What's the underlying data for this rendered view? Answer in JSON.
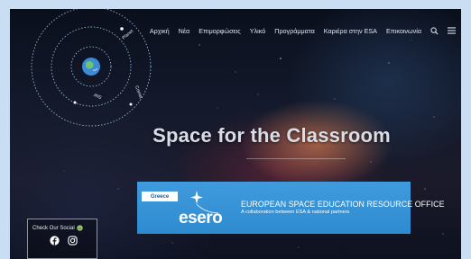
{
  "nav": {
    "items": [
      {
        "label": "Αρχική"
      },
      {
        "label": "Νέα"
      },
      {
        "label": "Επιμορφώσεις"
      },
      {
        "label": "Υλικό"
      },
      {
        "label": "Προγράμματα"
      },
      {
        "label": "Καριέρα στην ESA"
      },
      {
        "label": "Επικοινωνία"
      }
    ],
    "search_icon": "search-icon",
    "menu_icon": "hamburger-menu-icon"
  },
  "orbit": {
    "labels": [
      "Planet",
      "Comet",
      "Star"
    ]
  },
  "hero": {
    "title": "Space for the Classroom"
  },
  "banner": {
    "country": "Greece",
    "logo_text": "esero",
    "title": "EUROPEAN SPACE EDUCATION RESOURCE OFFICE",
    "subtitle": "A collaboration between ESA & national partners",
    "color": "#3a97da"
  },
  "social": {
    "label": "Check Our Social",
    "icons": [
      "facebook-icon",
      "instagram-icon"
    ]
  },
  "colors": {
    "page_background": "#c9def2",
    "nav_text": "#dfe6f2",
    "banner_blue": "#3a97da"
  }
}
